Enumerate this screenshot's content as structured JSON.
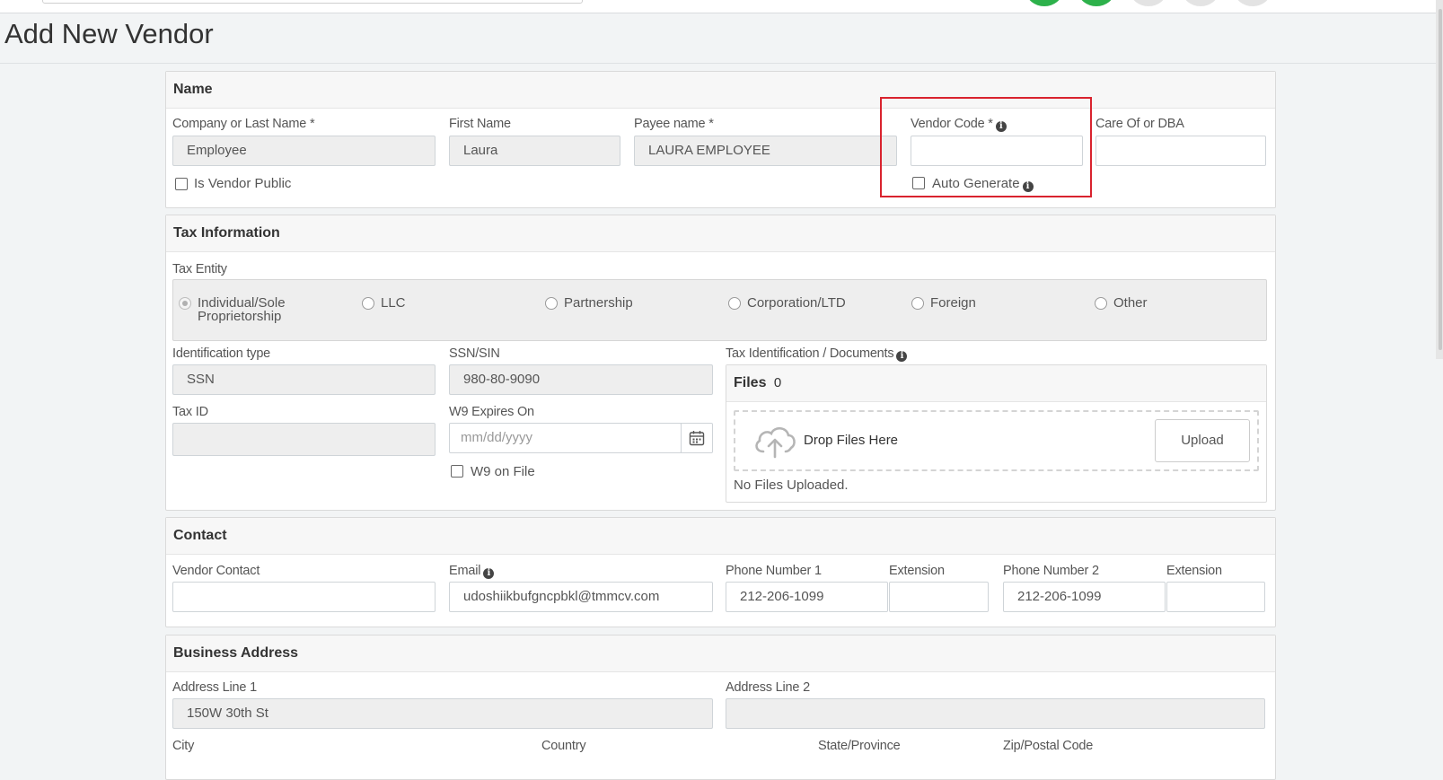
{
  "page": {
    "title": "Add New Vendor"
  },
  "name_section": {
    "heading": "Name",
    "company_label": "Company or Last Name *",
    "company_value": "Employee",
    "first_name_label": "First Name",
    "first_name_value": "Laura",
    "payee_label": "Payee name *",
    "payee_value": "LAURA EMPLOYEE",
    "vendor_code_label": "Vendor Code *",
    "vendor_code_value": "",
    "care_of_label": "Care Of or DBA",
    "care_of_value": "",
    "is_vendor_public_label": "Is Vendor Public",
    "auto_generate_label": "Auto Generate"
  },
  "tax_section": {
    "heading": "Tax Information",
    "tax_entity_label": "Tax Entity",
    "entities": [
      {
        "line1": "Individual/Sole",
        "line2": "Proprietorship",
        "selected": true
      },
      {
        "line1": "LLC",
        "line2": "",
        "selected": false
      },
      {
        "line1": "Partnership",
        "line2": "",
        "selected": false
      },
      {
        "line1": "Corporation/LTD",
        "line2": "",
        "selected": false
      },
      {
        "line1": "Foreign",
        "line2": "",
        "selected": false
      },
      {
        "line1": "Other",
        "line2": "",
        "selected": false
      }
    ],
    "id_type_label": "Identification type",
    "id_type_value": "SSN",
    "ssn_label": "SSN/SIN",
    "ssn_value": "980-80-9090",
    "tax_docs_label": "Tax Identification / Documents",
    "files_heading": "Files",
    "files_count": "0",
    "drop_text": "Drop Files Here",
    "upload_label": "Upload",
    "no_files_text": "No Files Uploaded.",
    "tax_id_label": "Tax ID",
    "tax_id_value": "",
    "w9_label": "W9 Expires On",
    "w9_placeholder": "mm/dd/yyyy",
    "w9_on_file_label": "W9 on File"
  },
  "contact_section": {
    "heading": "Contact",
    "vendor_contact_label": "Vendor Contact",
    "vendor_contact_value": "",
    "email_label": "Email",
    "email_value": "udoshiikbufgncpbkl@tmmcv.com",
    "phone1_label": "Phone Number 1",
    "phone1_value": "212-206-1099",
    "ext1_label": "Extension",
    "ext1_value": "",
    "phone2_label": "Phone Number 2",
    "phone2_value": "212-206-1099",
    "ext2_label": "Extension",
    "ext2_value": ""
  },
  "address_section": {
    "heading": "Business Address",
    "line1_label": "Address Line 1",
    "line1_value": "150W 30th St",
    "line2_label": "Address Line 2",
    "line2_value": "",
    "city_label": "City",
    "country_label": "Country",
    "state_label": "State/Province",
    "zip_label": "Zip/Postal Code"
  },
  "colors": {
    "highlight": "#d9232e",
    "status_green": "#2db14b",
    "status_grey": "#e3e3e3"
  }
}
